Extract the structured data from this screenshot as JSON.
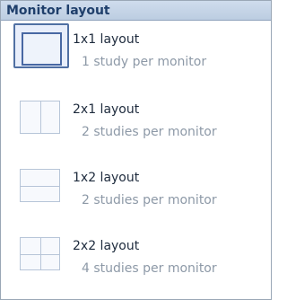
{
  "panel": {
    "title": "Monitor layout"
  },
  "items": [
    {
      "title": "1x1 layout",
      "subtitle": "1 study per monitor",
      "icon": "layout-1x1-icon",
      "selected": true
    },
    {
      "title": "2x1 layout",
      "subtitle": "2 studies per monitor",
      "icon": "layout-2x1-icon",
      "selected": false
    },
    {
      "title": "1x2 layout",
      "subtitle": "2 studies per monitor",
      "icon": "layout-1x2-icon",
      "selected": false
    },
    {
      "title": "2x2 layout",
      "subtitle": "4 studies per monitor",
      "icon": "layout-2x2-icon",
      "selected": false
    }
  ],
  "colors": {
    "header_bg": "#c6d6ea",
    "header_text": "#1f3f6b",
    "selected_border": "#4868a3",
    "secondary_text": "#8d99a7"
  }
}
